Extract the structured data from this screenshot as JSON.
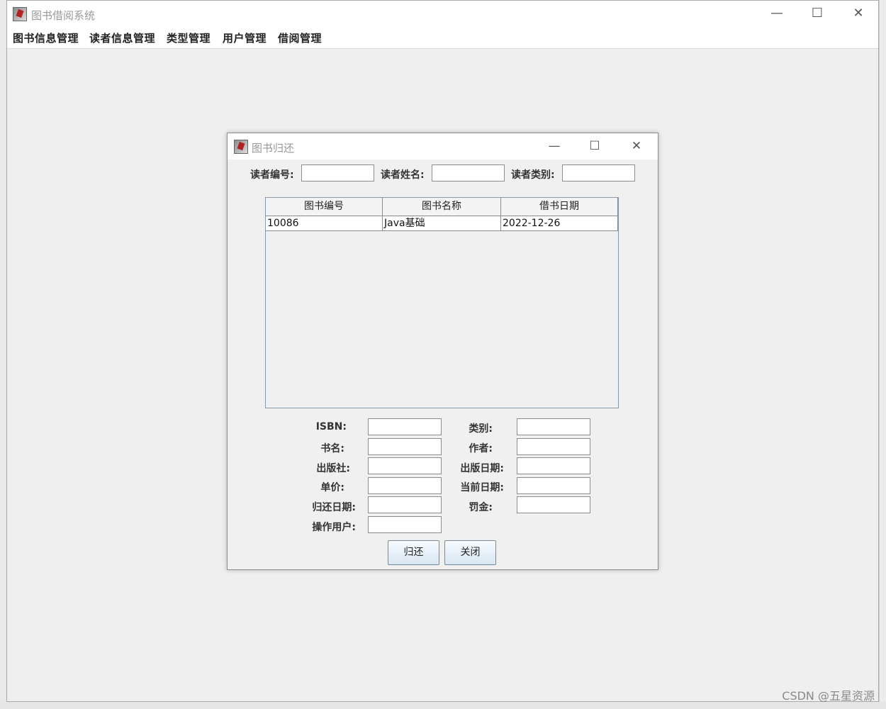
{
  "main_window": {
    "title": "图书借阅系统",
    "controls": {
      "minimize": "—",
      "maximize": "☐",
      "close": "✕"
    },
    "menu": [
      "图书信息管理",
      "读者信息管理",
      "类型管理",
      "用户管理",
      "借阅管理"
    ]
  },
  "dialog": {
    "title": "图书归还",
    "controls": {
      "minimize": "—",
      "maximize": "☐",
      "close": "✕"
    },
    "reader": {
      "id_label": "读者编号:",
      "name_label": "读者姓名:",
      "type_label": "读者类别:",
      "id_value": "",
      "name_value": "",
      "type_value": ""
    },
    "table": {
      "headers": [
        "图书编号",
        "图书名称",
        "借书日期"
      ],
      "rows": [
        [
          "10086",
          "Java基础",
          "2022-12-26"
        ]
      ]
    },
    "form": {
      "isbn_label": "ISBN:",
      "category_label": "类别:",
      "title_label": "书名:",
      "author_label": "作者:",
      "publisher_label": "出版社:",
      "pub_date_label": "出版日期:",
      "price_label": "单价:",
      "current_date_label": "当前日期:",
      "return_date_label": "归还日期:",
      "fine_label": "罚金:",
      "operator_label": "操作用户:",
      "isbn": "",
      "category": "",
      "title": "",
      "author": "",
      "publisher": "",
      "pub_date": "",
      "price": "",
      "current_date": "",
      "return_date": "",
      "fine": "",
      "operator": ""
    },
    "buttons": {
      "return": "归还",
      "close": "关闭"
    }
  },
  "watermark": "CSDN @五星资源"
}
